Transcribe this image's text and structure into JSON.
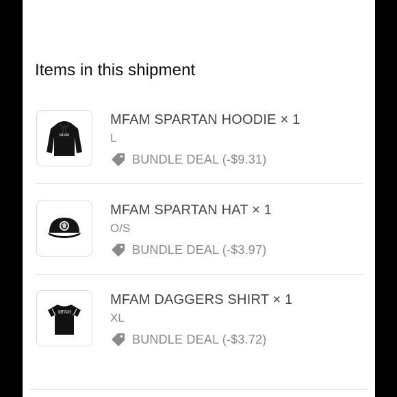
{
  "shipment": {
    "title": "Items in this shipment",
    "items": [
      {
        "name": "MFAM SPARTAN HOODIE × 1",
        "variant": "L",
        "deal": "BUNDLE DEAL (-$9.31)",
        "image_icon": "hoodie-image",
        "image_text": "MFAM"
      },
      {
        "name": "MFAM SPARTAN HAT × 1",
        "variant": "O/S",
        "deal": "BUNDLE DEAL (-$3.97)",
        "image_icon": "hat-image"
      },
      {
        "name": "MFAM DAGGERS SHIRT × 1",
        "variant": "XL",
        "deal": "BUNDLE DEAL (-$3.72)",
        "image_icon": "shirt-image",
        "image_text": "MFAM"
      }
    ]
  },
  "colors": {
    "background": "#000000",
    "panel": "#ffffff",
    "tag_icon": "#8a8a8a",
    "name_text": "#444444",
    "muted_text": "#8a8a8a"
  }
}
